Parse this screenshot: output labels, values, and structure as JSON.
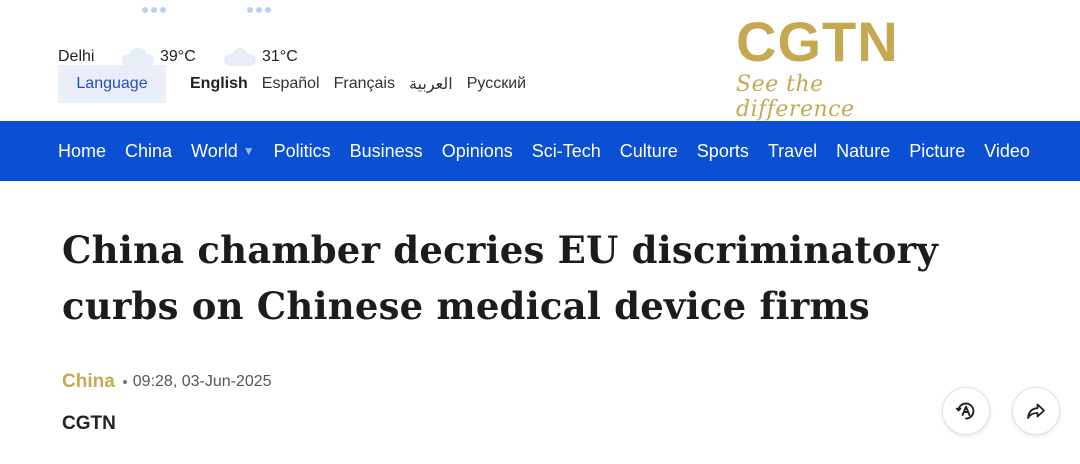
{
  "weather": [
    {
      "city": "Delhi",
      "temp": "39°C"
    },
    {
      "city": "",
      "temp": "31°C"
    }
  ],
  "language": {
    "label": "Language",
    "options": [
      "English",
      "Español",
      "Français",
      "العربية",
      "Русский"
    ],
    "active": "English"
  },
  "logo": {
    "main": "CGTN",
    "tagline": "See the difference"
  },
  "nav": {
    "items": [
      "Home",
      "China",
      "World",
      "Politics",
      "Business",
      "Opinions",
      "Sci-Tech",
      "Culture",
      "Sports",
      "Travel",
      "Nature",
      "Picture",
      "Video"
    ],
    "dropdown_item": "World"
  },
  "article": {
    "headline": "China chamber decries EU discriminatory curbs on Chinese medical device firms",
    "category": "China",
    "timestamp": "09:28, 03-Jun-2025",
    "source": "CGTN"
  },
  "icons": {
    "accessibility": "accessibility-icon",
    "share": "share-icon"
  },
  "colors": {
    "nav_bg": "#0a4fd4",
    "brand_gold": "#c5a952",
    "language_btn_bg": "#e9eef8",
    "language_btn_text": "#1e4fc2"
  }
}
